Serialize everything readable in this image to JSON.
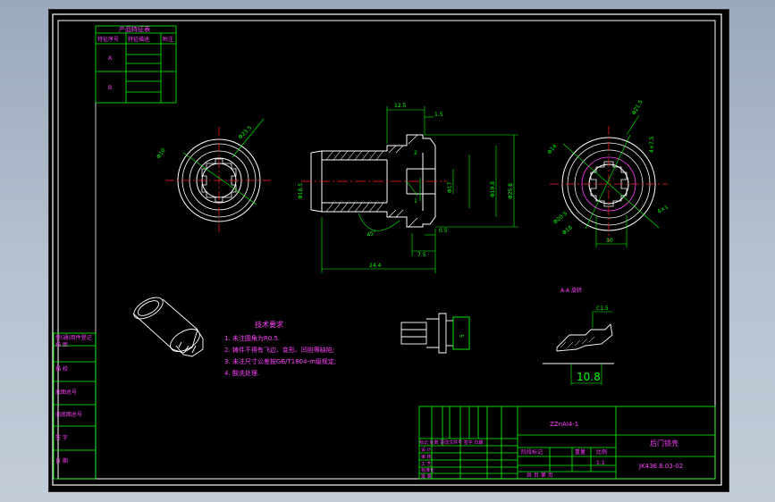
{
  "part_features_table": {
    "title": "产品特征表",
    "headers": [
      "特征序号",
      "特征描述",
      "附注"
    ],
    "rows": [
      "A",
      "B"
    ]
  },
  "dimensions": {
    "d_12_5": "12.5",
    "d_1_5": "1.5",
    "d_2": "2",
    "d_1": "1",
    "d_18_5": "Φ18.5",
    "d_17": "Φ17",
    "d_19_8": "Φ19.8",
    "d_25_8": "Φ25.8",
    "d_0_5": "0.5",
    "d_7_5": "7.5",
    "d_24_4": "24.4",
    "angle_45": "45°",
    "d_10": "10",
    "d_5": "5",
    "d_10_8": "10.8",
    "c_1_5": "C1.5"
  },
  "section_label": "A-A 旋转",
  "tech_requirements": {
    "title": "技术要求",
    "items": [
      "1. 未注圆角为R0.5.",
      "2. 铸件不得有飞边、变形、凹陷等缺陷;",
      "3. 未注尺寸公差按GB/T1804-m级规定;",
      "4. 酸洗处理."
    ]
  },
  "left_strip": {
    "items": [
      "借(通)用件登记",
      "描    图",
      "描    校",
      "底图总号",
      "旧底图总号",
      "签    字",
      "日    期"
    ]
  },
  "title_block": {
    "material": "ZZnAl4-1",
    "part_name": "后门锁壳",
    "drawing_number": "JK436.8.03-02",
    "stage_label": "阶段标记",
    "weight_label": "重量",
    "scale_label": "比例",
    "scale_value": "1:1",
    "sheet_label": "共    页  第    页",
    "revision_header": "标记 处数 更改文件号 签字 日期",
    "roles": [
      "设 计",
      "审 核",
      "工 艺",
      "标准化",
      "批 准"
    ]
  }
}
